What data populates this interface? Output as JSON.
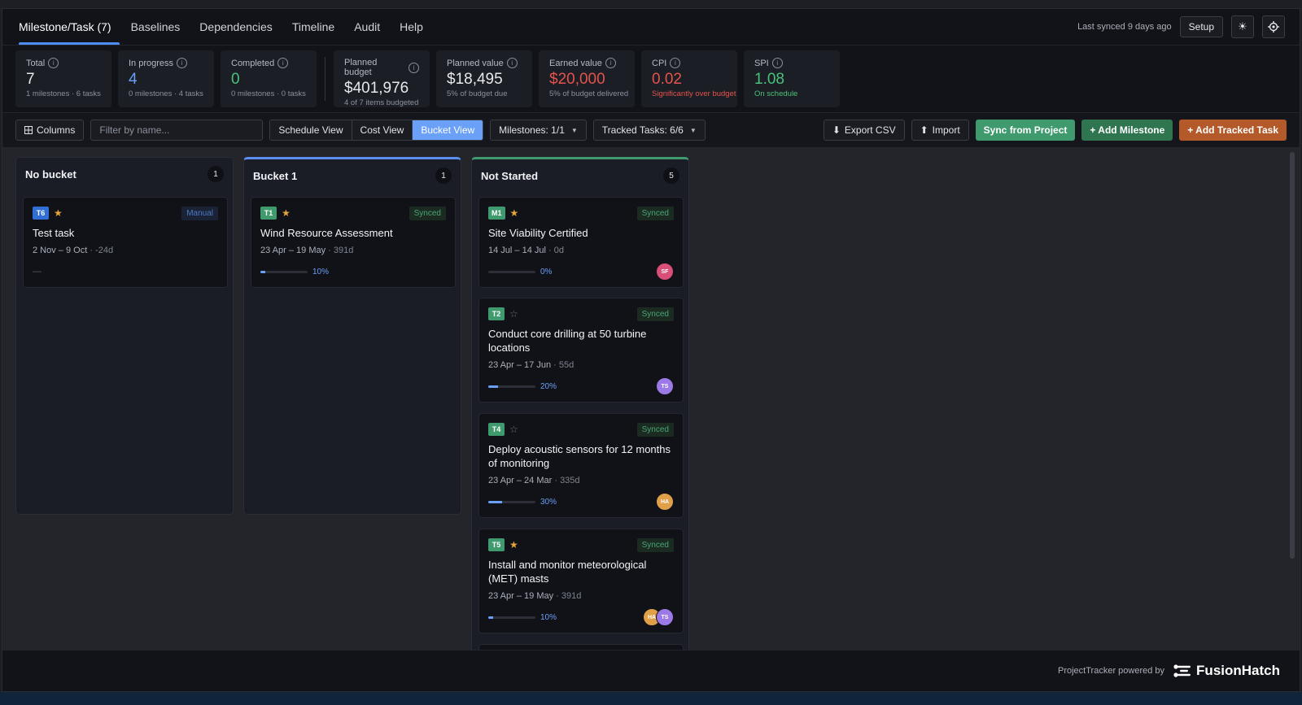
{
  "nav": {
    "tabs": [
      {
        "label": "Milestone/Task (7)"
      },
      {
        "label": "Baselines"
      },
      {
        "label": "Dependencies"
      },
      {
        "label": "Timeline"
      },
      {
        "label": "Audit"
      },
      {
        "label": "Help"
      }
    ],
    "sync_status": "Last synced 9 days ago",
    "setup_label": "Setup"
  },
  "kpis": {
    "total": {
      "label": "Total",
      "value": "7",
      "sub": "1 milestones · 6 tasks"
    },
    "in_progress": {
      "label": "In progress",
      "value": "4",
      "sub": "0 milestones · 4 tasks"
    },
    "completed": {
      "label": "Completed",
      "value": "0",
      "sub": "0 milestones · 0 tasks"
    },
    "planned_budget": {
      "label": "Planned budget",
      "value": "$401,976",
      "sub": "4 of 7 items budgeted"
    },
    "planned_value": {
      "label": "Planned value",
      "value": "$18,495",
      "sub": "5% of budget due"
    },
    "earned_value": {
      "label": "Earned value",
      "value": "$20,000",
      "sub": "5% of budget delivered"
    },
    "cpi": {
      "label": "CPI",
      "value": "0.02",
      "sub": "Significantly over budget"
    },
    "spi": {
      "label": "SPI",
      "value": "1.08",
      "sub": "On schedule"
    }
  },
  "colors": {
    "accent": "#6aa0f7",
    "positive": "#49c27a",
    "negative": "#e5534b",
    "sync_button": "#3f9a6e",
    "add_milestone": "#2f7550",
    "add_task": "#b4592a"
  },
  "toolbar": {
    "columns_label": "Columns",
    "filter_placeholder": "Filter by name...",
    "views": [
      "Schedule View",
      "Cost View",
      "Bucket View"
    ],
    "active_view": "Bucket View",
    "milestones_filter": "Milestones: 1/1",
    "tracked_tasks_filter": "Tracked Tasks: 6/6",
    "export_label": "Export CSV",
    "import_label": "Import",
    "sync_label": "Sync from Project",
    "add_milestone_label": "+ Add Milestone",
    "add_task_label": "+ Add Tracked Task"
  },
  "columns": [
    {
      "title": "No bucket",
      "count": "1",
      "cards": [
        {
          "id": "T6",
          "starred": true,
          "source": "Manual",
          "title": "Test task",
          "dates": "2 Nov – 9 Oct",
          "duration": "· -24d",
          "progress": null,
          "empty_marker": "—",
          "avatars": []
        }
      ]
    },
    {
      "title": "Bucket 1",
      "count": "1",
      "cards": [
        {
          "id": "T1",
          "starred": true,
          "source": "Synced",
          "title": "Wind Resource Assessment",
          "dates": "23 Apr – 19 May",
          "duration": "· 391d",
          "progress": 10,
          "progress_label": "10%",
          "avatars": []
        }
      ]
    },
    {
      "title": "Not Started",
      "count": "5",
      "cards": [
        {
          "id": "M1",
          "starred": true,
          "source": "Synced",
          "title": "Site Viability Certified",
          "dates": "14 Jul – 14 Jul",
          "duration": "· 0d",
          "progress": 0,
          "progress_label": "0%",
          "avatars": [
            {
              "initials": "SF",
              "color": "#d94f7a"
            }
          ]
        },
        {
          "id": "T2",
          "starred": false,
          "source": "Synced",
          "title": "Conduct core drilling at 50 turbine locations",
          "dates": "23 Apr – 17 Jun",
          "duration": "· 55d",
          "progress": 20,
          "progress_label": "20%",
          "avatars": [
            {
              "initials": "TS",
              "color": "#9b7ae8"
            }
          ]
        },
        {
          "id": "T4",
          "starred": false,
          "source": "Synced",
          "title": "Deploy acoustic sensors for 12 months of monitoring",
          "dates": "23 Apr – 24 Mar",
          "duration": "· 335d",
          "progress": 30,
          "progress_label": "30%",
          "avatars": [
            {
              "initials": "HA",
              "color": "#e0a04a"
            }
          ]
        },
        {
          "id": "T5",
          "starred": true,
          "source": "Synced",
          "title": "Install and monitor meteorological (MET) masts",
          "dates": "23 Apr – 19 May",
          "duration": "· 391d",
          "progress": 10,
          "progress_label": "10%",
          "avatars": [
            {
              "initials": "HA",
              "color": "#e0a04a"
            },
            {
              "initials": "TS",
              "color": "#9b7ae8"
            }
          ]
        }
      ]
    }
  ],
  "footer": {
    "powered_by": "ProjectTracker powered by",
    "brand": "FusionHatch"
  }
}
